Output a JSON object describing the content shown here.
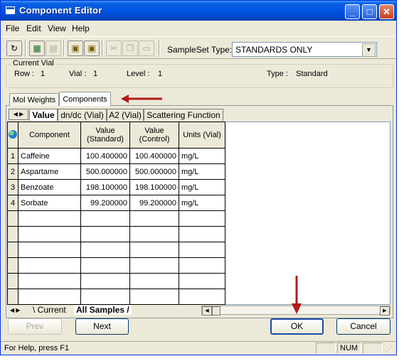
{
  "window": {
    "title": "Component Editor"
  },
  "menu": [
    "File",
    "Edit",
    "View",
    "Help"
  ],
  "toolbar": {
    "sampleset_label": "SampleSet Type:",
    "sampleset_value": "STANDARDS ONLY"
  },
  "current_vial": {
    "legend": "Current Vial",
    "row_label": "Row :",
    "row_value": "1",
    "vial_label": "Vial :",
    "vial_value": "1",
    "level_label": "Level :",
    "level_value": "1",
    "type_label": "Type :",
    "type_value": "Standard"
  },
  "outer_tabs": [
    "Mol Weights",
    "Components"
  ],
  "inner_tabs": [
    "Value",
    "dn/dc (Vial)",
    "A2 (Vial)",
    "Scattering Function"
  ],
  "grid": {
    "headers": [
      "Component",
      "Value (Standard)",
      "Value (Control)",
      "Units (Vial)"
    ],
    "rows": [
      {
        "num": "1",
        "component": "Caffeine",
        "standard": "100.400000",
        "control": "100.400000",
        "units": "mg/L"
      },
      {
        "num": "2",
        "component": "Aspartame",
        "standard": "500.000000",
        "control": "500.000000",
        "units": "mg/L"
      },
      {
        "num": "3",
        "component": "Benzoate",
        "standard": "198.100000",
        "control": "198.100000",
        "units": "mg/L"
      },
      {
        "num": "4",
        "component": "Sorbate",
        "standard": "99.200000",
        "control": "99.200000",
        "units": "mg/L"
      }
    ],
    "empty_rows": 6
  },
  "sheet_tabs": {
    "current": "Current",
    "all_samples": "All Samples"
  },
  "buttons": {
    "prev": "Prev",
    "next": "Next",
    "ok": "OK",
    "cancel": "Cancel"
  },
  "status": {
    "help_text": "For Help, press F1",
    "num": "NUM"
  },
  "colors": {
    "titlebar": "#0054e3",
    "annotation_arrow": "#b31a1a",
    "dialog_bg": "#ece9d8"
  }
}
